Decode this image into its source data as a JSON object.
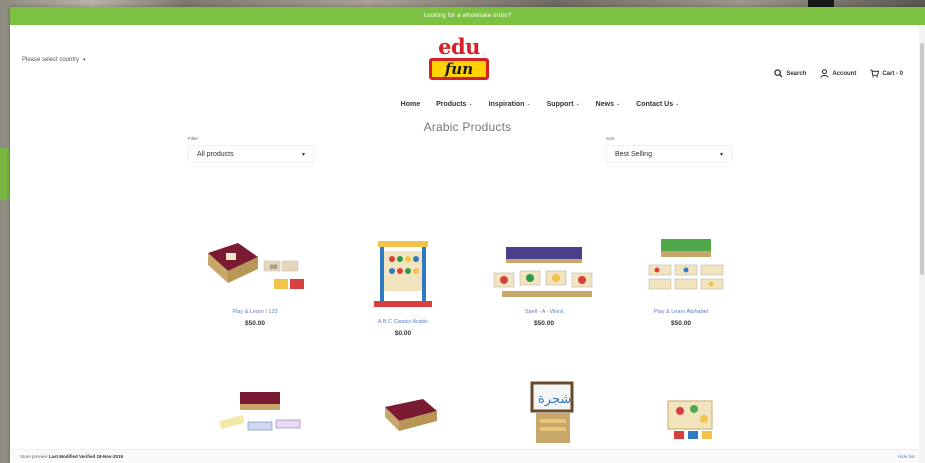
{
  "announcement": "Looking for a wholesale order?",
  "header": {
    "country_select": "Please select country",
    "logo_top": "edu",
    "logo_bottom": "fun",
    "search": "Search",
    "account": "Account",
    "cart": "Cart - 0"
  },
  "nav": [
    {
      "label": "Home",
      "has_menu": false
    },
    {
      "label": "Products",
      "has_menu": true
    },
    {
      "label": "Inspiration",
      "has_menu": true
    },
    {
      "label": "Support",
      "has_menu": true
    },
    {
      "label": "News",
      "has_menu": true
    },
    {
      "label": "Contact Us",
      "has_menu": true
    }
  ],
  "page_title": "Arabic Products",
  "filters": {
    "filter_label": "Filter",
    "filter_value": "All products",
    "sort_label": "Sort",
    "sort_value": "Best Selling"
  },
  "products": [
    {
      "name": "Play & Learn / 123",
      "price": "$50.00"
    },
    {
      "name": "A B C Classic Arabic",
      "price": "$0.00"
    },
    {
      "name": "Spell - A - Word",
      "price": "$50.00"
    },
    {
      "name": "Play & Learn Alphabet",
      "price": "$50.00"
    }
  ],
  "footer": {
    "preview_prefix": "Store preview",
    "last_modified": "Last Modified Verified 18-Nov-2019",
    "hide": "Hide bar"
  }
}
